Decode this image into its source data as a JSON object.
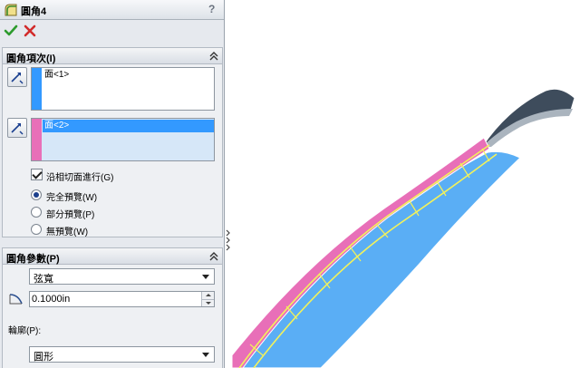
{
  "panel": {
    "title": "圓角4",
    "help": "?"
  },
  "items_group": {
    "title": "圓角項次(I)",
    "selection1": "面<1>",
    "selection2": "面<2>",
    "tangent_propagation": "沿相切面進行(G)",
    "preview_options": [
      {
        "label": "完全預覽(W)",
        "selected": true
      },
      {
        "label": "部分預覽(P)",
        "selected": false
      },
      {
        "label": "無預覽(W)",
        "selected": false
      }
    ]
  },
  "params_group": {
    "title": "圓角參數(P)",
    "method": "弦寬",
    "distance": "0.1000in",
    "profile_label": "輪廓(P):",
    "profile": "圓形"
  },
  "colors": {
    "selection1_stripe": "#3399ff",
    "selection2_stripe": "#e86fb8",
    "face_blue": "#5aaef5",
    "face_pink": "#e86fb8",
    "edge_yellow": "#f3f25a",
    "dark_shell": "#3e4c5c"
  }
}
